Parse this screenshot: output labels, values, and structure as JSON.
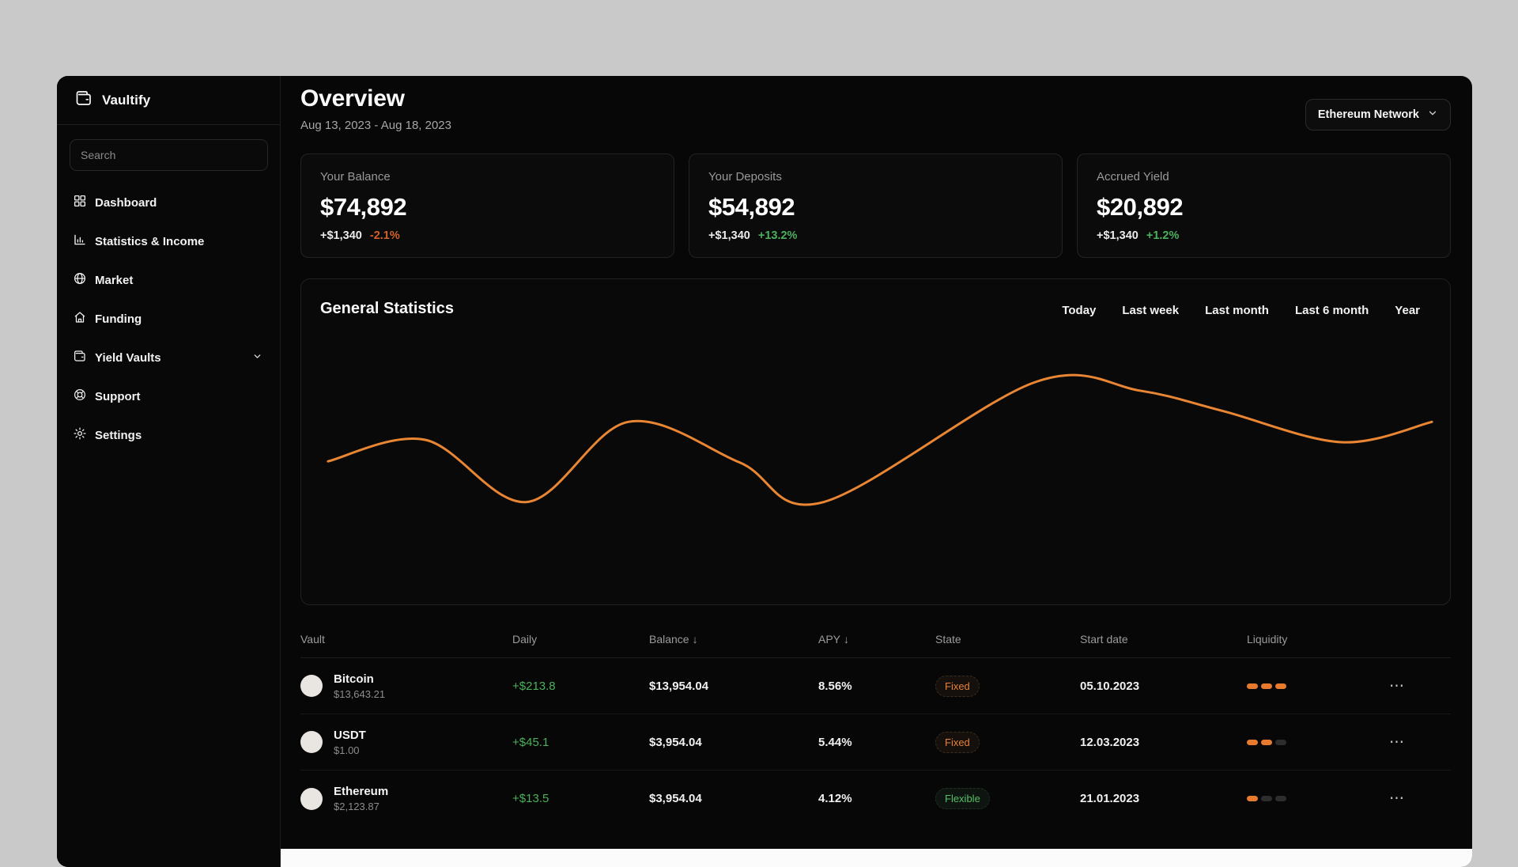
{
  "app": {
    "name": "Vaultify"
  },
  "sidebar": {
    "search_placeholder": "Search",
    "items": [
      {
        "label": "Dashboard",
        "icon": "dashboard-grid-icon"
      },
      {
        "label": "Statistics & Income",
        "icon": "bar-chart-icon"
      },
      {
        "label": "Market",
        "icon": "globe-icon"
      },
      {
        "label": "Funding",
        "icon": "home-icon"
      },
      {
        "label": "Yield Vaults",
        "icon": "wallet-icon",
        "has_chevron": true
      },
      {
        "label": "Support",
        "icon": "lifebuoy-icon"
      },
      {
        "label": "Settings",
        "icon": "gear-icon"
      }
    ]
  },
  "header": {
    "title": "Overview",
    "date_range": "Aug 13, 2023 - Aug 18, 2023",
    "network_selector": "Ethereum Network"
  },
  "stat_cards": [
    {
      "label": "Your Balance",
      "value": "$74,892",
      "delta": "+$1,340",
      "delta_pct": "-2.1%",
      "trend": "down"
    },
    {
      "label": "Your Deposits",
      "value": "$54,892",
      "delta": "+$1,340",
      "delta_pct": "+13.2%",
      "trend": "up"
    },
    {
      "label": "Accrued Yield",
      "value": "$20,892",
      "delta": "+$1,340",
      "delta_pct": "+1.2%",
      "trend": "up"
    }
  ],
  "statistics": {
    "title": "General Statistics",
    "filters": [
      "Today",
      "Last week",
      "Last month",
      "Last 6 month",
      "Year"
    ],
    "chart_data": {
      "type": "line",
      "title": "General Statistics",
      "xlabel": "",
      "ylabel": "",
      "axes_visible": false,
      "grid": false,
      "legend": "none",
      "color": "#e98634",
      "series": [
        {
          "name": "balance-curve",
          "points": [
            {
              "x": 0,
              "v": 34
            },
            {
              "x": 8.8,
              "v": 52
            },
            {
              "x": 18.0,
              "v": 0
            },
            {
              "x": 27.2,
              "v": 67
            },
            {
              "x": 37.3,
              "v": 33
            },
            {
              "x": 44.9,
              "v": 0
            },
            {
              "x": 64.0,
              "v": 100
            },
            {
              "x": 73.6,
              "v": 93
            },
            {
              "x": 81.1,
              "v": 76
            },
            {
              "x": 91.8,
              "v": 50
            },
            {
              "x": 100,
              "v": 67
            }
          ]
        }
      ]
    }
  },
  "table": {
    "columns": [
      {
        "label": "Vault",
        "sort": ""
      },
      {
        "label": "Daily",
        "sort": ""
      },
      {
        "label": "Balance",
        "sort": "↓"
      },
      {
        "label": "APY",
        "sort": "↓"
      },
      {
        "label": "State",
        "sort": ""
      },
      {
        "label": "Start date",
        "sort": ""
      },
      {
        "label": "Liquidity",
        "sort": ""
      }
    ],
    "rows": [
      {
        "name": "Bitcoin",
        "price": "$13,643.21",
        "daily": "+$213.8",
        "balance": "$13,954.04",
        "apy": "8.56%",
        "state": "Fixed",
        "state_color": "orange",
        "start_date": "05.10.2023",
        "liquidity": 3
      },
      {
        "name": "USDT",
        "price": "$1.00",
        "daily": "+$45.1",
        "balance": "$3,954.04",
        "apy": "5.44%",
        "state": "Fixed",
        "state_color": "orange",
        "start_date": "12.03.2023",
        "liquidity": 2
      },
      {
        "name": "Ethereum",
        "price": "$2,123.87",
        "daily": "+$13.5",
        "balance": "$3,954.04",
        "apy": "4.12%",
        "state": "Flexible",
        "state_color": "green",
        "start_date": "21.01.2023",
        "liquidity": 1
      }
    ]
  },
  "icons": {
    "ellipsis": "⋯"
  },
  "colors": {
    "page_bg": "#c9c9c9",
    "panel_bg": "#070707",
    "card_border": "#232323",
    "accent_orange": "#e98634",
    "positive_green": "#4cb05c",
    "negative_orange": "#d3612a",
    "pill_fixed": "#e8813a",
    "pill_flexible": "#55c166",
    "liquidity_on": "#e87a2e",
    "liquidity_off": "#2d2d2d"
  }
}
